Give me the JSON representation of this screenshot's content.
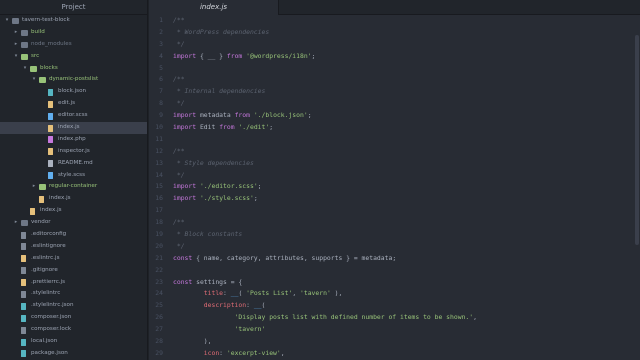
{
  "project_panel": {
    "title": "Project",
    "items": [
      {
        "label": "tavern-test-block",
        "depth": 0,
        "type": "folder",
        "expanded": true
      },
      {
        "label": "build",
        "depth": 1,
        "type": "folder",
        "expanded": false
      },
      {
        "label": "node_modules",
        "depth": 1,
        "type": "folder",
        "expanded": false,
        "dim": true
      },
      {
        "label": "src",
        "depth": 1,
        "type": "folder",
        "expanded": true
      },
      {
        "label": "blocks",
        "depth": 2,
        "type": "folder",
        "expanded": true
      },
      {
        "label": "dynamic-postslist",
        "depth": 3,
        "type": "folder",
        "expanded": true
      },
      {
        "label": "block.json",
        "depth": 4,
        "type": "file",
        "ext": "json"
      },
      {
        "label": "edit.js",
        "depth": 4,
        "type": "file",
        "ext": "js"
      },
      {
        "label": "editor.scss",
        "depth": 4,
        "type": "file",
        "ext": "css"
      },
      {
        "label": "index.js",
        "depth": 4,
        "type": "file",
        "ext": "js",
        "selected": true
      },
      {
        "label": "index.php",
        "depth": 4,
        "type": "file",
        "ext": "php"
      },
      {
        "label": "inspector.js",
        "depth": 4,
        "type": "file",
        "ext": "js"
      },
      {
        "label": "README.md",
        "depth": 4,
        "type": "file",
        "ext": "md"
      },
      {
        "label": "style.scss",
        "depth": 4,
        "type": "file",
        "ext": "css"
      },
      {
        "label": "regular-container",
        "depth": 3,
        "type": "folder",
        "expanded": false
      },
      {
        "label": "index.js",
        "depth": 3,
        "type": "file",
        "ext": "js"
      },
      {
        "label": "index.js",
        "depth": 2,
        "type": "file",
        "ext": "js"
      },
      {
        "label": "vendor",
        "depth": 1,
        "type": "folder",
        "expanded": false
      },
      {
        "label": ".editorconfig",
        "depth": 1,
        "type": "file",
        "ext": "cfg"
      },
      {
        "label": ".eslintignore",
        "depth": 1,
        "type": "file",
        "ext": "cfg"
      },
      {
        "label": ".eslintrc.js",
        "depth": 1,
        "type": "file",
        "ext": "js"
      },
      {
        "label": ".gitignore",
        "depth": 1,
        "type": "file",
        "ext": "cfg"
      },
      {
        "label": ".prettierrc.js",
        "depth": 1,
        "type": "file",
        "ext": "js"
      },
      {
        "label": ".stylelintrc",
        "depth": 1,
        "type": "file",
        "ext": "cfg"
      },
      {
        "label": ".stylelintrc.json",
        "depth": 1,
        "type": "file",
        "ext": "json"
      },
      {
        "label": "composer.json",
        "depth": 1,
        "type": "file",
        "ext": "json"
      },
      {
        "label": "composer.lock",
        "depth": 1,
        "type": "file",
        "ext": "cfg"
      },
      {
        "label": "local.json",
        "depth": 1,
        "type": "file",
        "ext": "json"
      },
      {
        "label": "package.json",
        "depth": 1,
        "type": "file",
        "ext": "json"
      }
    ]
  },
  "editor": {
    "active_tab": "index.js",
    "lines": [
      {
        "n": "1",
        "tokens": [
          {
            "t": "/**",
            "c": "com"
          }
        ]
      },
      {
        "n": "2",
        "tokens": [
          {
            "t": " * WordPress dependencies",
            "c": "com"
          }
        ]
      },
      {
        "n": "3",
        "tokens": [
          {
            "t": " */",
            "c": "com"
          }
        ]
      },
      {
        "n": "4",
        "tokens": [
          {
            "t": "import",
            "c": "kw"
          },
          {
            "t": " { __ } "
          },
          {
            "t": "from",
            "c": "kw"
          },
          {
            "t": " "
          },
          {
            "t": "'@wordpress/i18n'",
            "c": "str"
          },
          {
            "t": ";"
          }
        ]
      },
      {
        "n": "5",
        "tokens": []
      },
      {
        "n": "6",
        "tokens": [
          {
            "t": "/**",
            "c": "com"
          }
        ]
      },
      {
        "n": "7",
        "tokens": [
          {
            "t": " * Internal dependencies",
            "c": "com"
          }
        ]
      },
      {
        "n": "8",
        "tokens": [
          {
            "t": " */",
            "c": "com"
          }
        ]
      },
      {
        "n": "9",
        "tokens": [
          {
            "t": "import",
            "c": "kw"
          },
          {
            "t": " metadata "
          },
          {
            "t": "from",
            "c": "kw"
          },
          {
            "t": " "
          },
          {
            "t": "'./block.json'",
            "c": "str"
          },
          {
            "t": ";"
          }
        ]
      },
      {
        "n": "10",
        "tokens": [
          {
            "t": "import",
            "c": "kw"
          },
          {
            "t": " Edit "
          },
          {
            "t": "from",
            "c": "kw"
          },
          {
            "t": " "
          },
          {
            "t": "'./edit'",
            "c": "str"
          },
          {
            "t": ";"
          }
        ]
      },
      {
        "n": "11",
        "tokens": []
      },
      {
        "n": "12",
        "tokens": [
          {
            "t": "/**",
            "c": "com"
          }
        ]
      },
      {
        "n": "13",
        "tokens": [
          {
            "t": " * Style dependencies",
            "c": "com"
          }
        ]
      },
      {
        "n": "14",
        "tokens": [
          {
            "t": " */",
            "c": "com"
          }
        ]
      },
      {
        "n": "15",
        "tokens": [
          {
            "t": "import",
            "c": "kw"
          },
          {
            "t": " "
          },
          {
            "t": "'./editor.scss'",
            "c": "str"
          },
          {
            "t": ";"
          }
        ]
      },
      {
        "n": "16",
        "tokens": [
          {
            "t": "import",
            "c": "kw"
          },
          {
            "t": " "
          },
          {
            "t": "'./style.scss'",
            "c": "str"
          },
          {
            "t": ";"
          }
        ]
      },
      {
        "n": "17",
        "tokens": []
      },
      {
        "n": "18",
        "tokens": [
          {
            "t": "/**",
            "c": "com"
          }
        ]
      },
      {
        "n": "19",
        "tokens": [
          {
            "t": " * Block constants",
            "c": "com"
          }
        ]
      },
      {
        "n": "20",
        "tokens": [
          {
            "t": " */",
            "c": "com"
          }
        ]
      },
      {
        "n": "21",
        "tokens": [
          {
            "t": "const",
            "c": "kw"
          },
          {
            "t": " { name, category, attributes, supports } = metadata;"
          }
        ]
      },
      {
        "n": "22",
        "tokens": []
      },
      {
        "n": "23",
        "tokens": [
          {
            "t": "const",
            "c": "kw"
          },
          {
            "t": " settings = {"
          }
        ]
      },
      {
        "n": "24",
        "tokens": [
          {
            "t": "        "
          },
          {
            "t": "title",
            "c": "prop"
          },
          {
            "t": ": "
          },
          {
            "t": "__",
            "c": "fn"
          },
          {
            "t": "( "
          },
          {
            "t": "'Posts List'",
            "c": "str"
          },
          {
            "t": ", "
          },
          {
            "t": "'tavern'",
            "c": "str"
          },
          {
            "t": " ),"
          }
        ]
      },
      {
        "n": "25",
        "tokens": [
          {
            "t": "        "
          },
          {
            "t": "description",
            "c": "prop"
          },
          {
            "t": ": "
          },
          {
            "t": "__",
            "c": "fn"
          },
          {
            "t": "("
          }
        ]
      },
      {
        "n": "26",
        "tokens": [
          {
            "t": "                "
          },
          {
            "t": "'Display posts list with defined number of items to be shown.'",
            "c": "str"
          },
          {
            "t": ","
          }
        ]
      },
      {
        "n": "27",
        "tokens": [
          {
            "t": "                "
          },
          {
            "t": "'tavern'",
            "c": "str"
          }
        ]
      },
      {
        "n": "28",
        "tokens": [
          {
            "t": "        ),"
          }
        ]
      },
      {
        "n": "29",
        "tokens": [
          {
            "t": "        "
          },
          {
            "t": "icon",
            "c": "prop"
          },
          {
            "t": ": "
          },
          {
            "t": "'excerpt-view'",
            "c": "str"
          },
          {
            "t": ","
          }
        ]
      }
    ]
  }
}
